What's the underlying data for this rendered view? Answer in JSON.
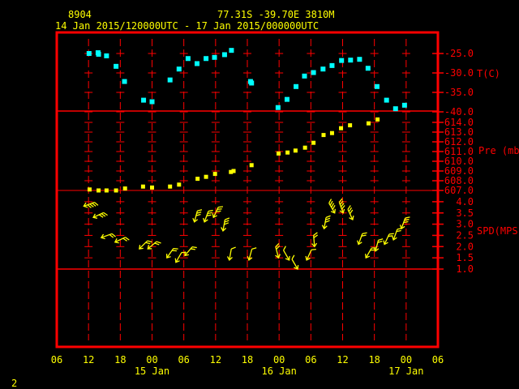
{
  "header": {
    "station_id": "8904",
    "location": "77.31S  -39.70E  3810M",
    "period": "14 Jan 2015/120000UTC - 17 Jan 2015/000000UTC"
  },
  "page_number": "2",
  "colors": {
    "frame": "#ff0000",
    "temperature": "#00ffff",
    "pressure": "#ffff00",
    "wind": "#ffff00",
    "text": "#ffff00"
  },
  "chart_data": {
    "type": "scatter",
    "x_unit": "hours since 14 Jan 2015 12 UTC",
    "xlim": [
      -6,
      66
    ],
    "x_ticks": [
      {
        "h": -6,
        "label": "06"
      },
      {
        "h": 0,
        "label": "12"
      },
      {
        "h": 6,
        "label": "18"
      },
      {
        "h": 12,
        "label": "00"
      },
      {
        "h": 18,
        "label": "06"
      },
      {
        "h": 24,
        "label": "12"
      },
      {
        "h": 30,
        "label": "18"
      },
      {
        "h": 36,
        "label": "00"
      },
      {
        "h": 42,
        "label": "06"
      },
      {
        "h": 48,
        "label": "12"
      },
      {
        "h": 54,
        "label": "18"
      },
      {
        "h": 60,
        "label": "00"
      },
      {
        "h": 66,
        "label": "06"
      }
    ],
    "date_labels": [
      {
        "h": 12,
        "label": "15 Jan"
      },
      {
        "h": 36,
        "label": "16 Jan"
      },
      {
        "h": 60,
        "label": "17 Jan"
      }
    ],
    "panels": {
      "temperature": {
        "label": "T(C)",
        "ylim": [
          -40,
          -24
        ],
        "ticks": [
          "-25.0",
          "-30.0",
          "-35.0",
          "-40.0"
        ],
        "tick_values": [
          -25,
          -30,
          -35,
          -40
        ],
        "points": [
          [
            0.1,
            -25.0
          ],
          [
            1.8,
            -24.8
          ],
          [
            1.9,
            -25.2
          ],
          [
            3.4,
            -25.6
          ],
          [
            5.2,
            -28.3
          ],
          [
            6.8,
            -32.2
          ],
          [
            10.4,
            -37.0
          ],
          [
            12.0,
            -37.4
          ],
          [
            15.4,
            -31.8
          ],
          [
            17.1,
            -29.0
          ],
          [
            18.8,
            -26.3
          ],
          [
            20.5,
            -27.6
          ],
          [
            22.2,
            -26.3
          ],
          [
            23.8,
            -26.0
          ],
          [
            25.7,
            -25.3
          ],
          [
            27.0,
            -24.2
          ],
          [
            30.6,
            -32.2
          ],
          [
            30.8,
            -32.6
          ],
          [
            35.8,
            -38.9
          ],
          [
            37.5,
            -36.8
          ],
          [
            39.2,
            -33.5
          ],
          [
            40.8,
            -30.8
          ],
          [
            42.5,
            -29.9
          ],
          [
            44.3,
            -29.0
          ],
          [
            46.0,
            -28.1
          ],
          [
            47.8,
            -26.8
          ],
          [
            49.5,
            -26.7
          ],
          [
            51.2,
            -26.5
          ],
          [
            52.8,
            -28.8
          ],
          [
            54.5,
            -33.5
          ],
          [
            56.3,
            -37.0
          ],
          [
            58.0,
            -39.2
          ],
          [
            59.7,
            -38.3
          ]
        ]
      },
      "pressure": {
        "label": "Pre (mb)",
        "ylim": [
          607,
          614.3
        ],
        "ticks": [
          "614.0",
          "613.0",
          "612.0",
          "611.0",
          "610.0",
          "609.0",
          "608.0",
          "607.0"
        ],
        "tick_values": [
          614,
          613,
          612,
          611,
          610,
          609,
          608,
          607
        ],
        "points": [
          [
            0.2,
            607.1
          ],
          [
            1.9,
            607.0
          ],
          [
            3.4,
            607.0
          ],
          [
            5.2,
            607.0
          ],
          [
            6.9,
            607.2
          ],
          [
            10.3,
            607.4
          ],
          [
            12.0,
            607.3
          ],
          [
            15.4,
            607.4
          ],
          [
            17.1,
            607.6
          ],
          [
            20.6,
            608.2
          ],
          [
            22.2,
            608.4
          ],
          [
            23.9,
            608.7
          ],
          [
            26.9,
            608.9
          ],
          [
            27.4,
            609.0
          ],
          [
            30.8,
            609.6
          ],
          [
            35.9,
            610.8
          ],
          [
            37.6,
            610.9
          ],
          [
            39.1,
            611.1
          ],
          [
            40.9,
            611.4
          ],
          [
            42.5,
            611.9
          ],
          [
            44.4,
            612.7
          ],
          [
            46.0,
            612.9
          ],
          [
            47.7,
            613.4
          ],
          [
            49.4,
            613.7
          ],
          [
            52.9,
            613.9
          ],
          [
            54.6,
            614.3
          ]
        ]
      },
      "wind_speed": {
        "label": "SPD(MPS)",
        "ylim": [
          1.0,
          4.0
        ],
        "ticks": [
          "4.0",
          "3.5",
          "3.0",
          "2.5",
          "2.0",
          "1.5",
          "1.0"
        ],
        "tick_values": [
          4.0,
          3.5,
          3.0,
          2.5,
          2.0,
          1.5,
          1.0
        ],
        "points_h_speed_heading": [
          [
            -0.9,
            3.8,
            250
          ],
          [
            0.9,
            3.3,
            245
          ],
          [
            2.4,
            2.4,
            250
          ],
          [
            5.0,
            2.2,
            245
          ],
          [
            9.6,
            1.9,
            225
          ],
          [
            11.2,
            1.9,
            230
          ],
          [
            14.8,
            1.5,
            215
          ],
          [
            16.5,
            1.3,
            210
          ],
          [
            18.2,
            1.6,
            220
          ],
          [
            20.0,
            3.1,
            195
          ],
          [
            21.9,
            3.1,
            200
          ],
          [
            23.6,
            3.3,
            205
          ],
          [
            25.4,
            2.7,
            190
          ],
          [
            26.6,
            1.4,
            190
          ],
          [
            30.3,
            1.4,
            195
          ],
          [
            35.9,
            1.5,
            165
          ],
          [
            37.9,
            1.4,
            150
          ],
          [
            39.5,
            1.0,
            150
          ],
          [
            41.2,
            1.4,
            205
          ],
          [
            42.7,
            2.0,
            175
          ],
          [
            44.5,
            2.8,
            190
          ],
          [
            46.5,
            3.5,
            150
          ],
          [
            48.1,
            3.5,
            160
          ],
          [
            49.9,
            3.2,
            155
          ],
          [
            51.0,
            2.1,
            200
          ],
          [
            52.4,
            1.5,
            210
          ],
          [
            54.2,
            1.8,
            195
          ],
          [
            55.9,
            2.1,
            205
          ],
          [
            57.6,
            2.3,
            200
          ],
          [
            59.1,
            2.8,
            200
          ]
        ]
      }
    }
  }
}
